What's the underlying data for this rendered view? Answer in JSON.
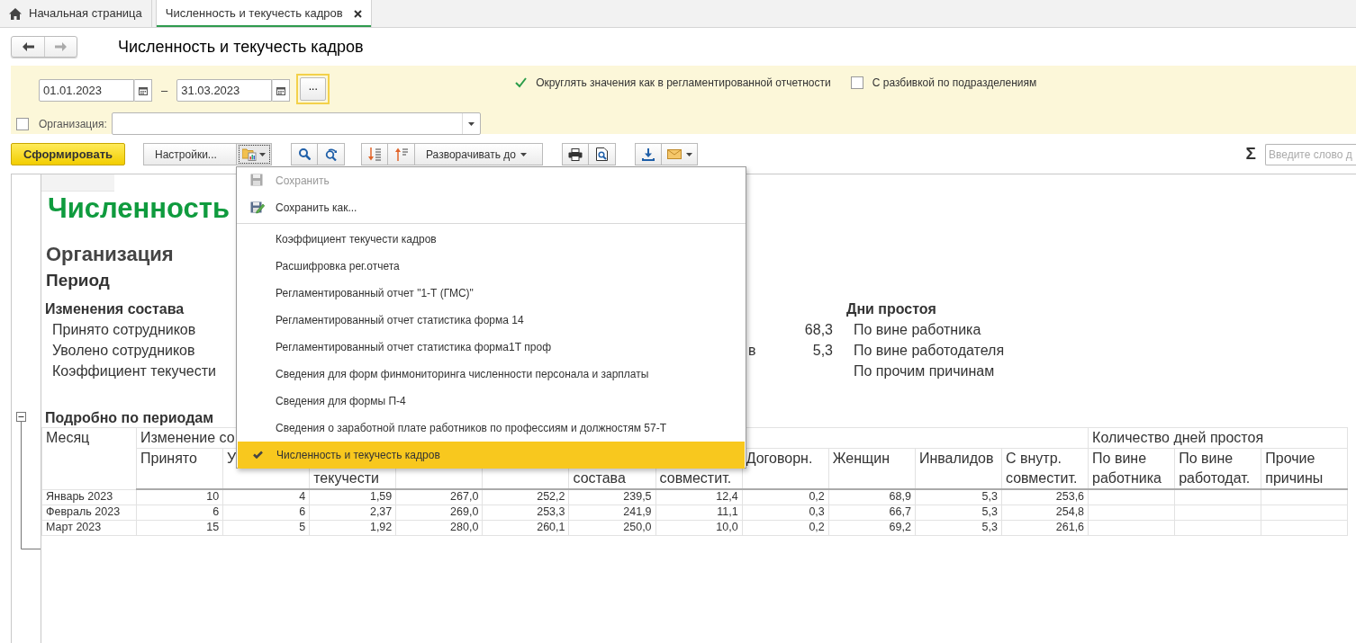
{
  "tabs": [
    {
      "label": "Начальная страница",
      "kind": "home",
      "selected": false,
      "closable": false
    },
    {
      "label": "Численность и текучесть кадров",
      "kind": "document",
      "selected": true,
      "closable": true
    }
  ],
  "title": "Численность и текучесть кадров",
  "filters": {
    "date_from": "01.01.2023",
    "dash": "–",
    "date_to": "31.03.2023",
    "more": "...",
    "options": [
      {
        "label": "Округлять значения как в регламентированной отчетности",
        "checked": true
      },
      {
        "label": "С разбивкой по подразделениям",
        "checked": false
      }
    ],
    "organization": {
      "label": "Организация:",
      "checked": false
    }
  },
  "toolbar": {
    "generate": "Сформировать",
    "settings": "Настройки...",
    "expand": "Разворачивать до",
    "sum": "Σ",
    "search_placeholder": "Введите слово д"
  },
  "menu": {
    "commands": [
      {
        "label": "Сохранить",
        "kind": "save",
        "disabled": true
      },
      {
        "label": "Сохранить как...",
        "kind": "save_as",
        "disabled": false
      }
    ],
    "variants": [
      {
        "label": "Коэффициент текучести кадров",
        "selected": false
      },
      {
        "label": "Расшифровка рег.отчета",
        "selected": false
      },
      {
        "label": "Регламентированный отчет \"1-Т (ГМС)\"",
        "selected": false
      },
      {
        "label": "Регламентированный отчет статистика форма 14",
        "selected": false
      },
      {
        "label": "Регламентированный отчет статистика форма1Т проф",
        "selected": false
      },
      {
        "label": "Сведения для форм финмониторинга численности персонала и зарплаты",
        "selected": false
      },
      {
        "label": "Сведения для формы П-4",
        "selected": false
      },
      {
        "label": "Сведения о заработной плате работников по профессиям и должностям 57-Т",
        "selected": false
      },
      {
        "label": "Численность и текучесть кадров",
        "selected": true
      }
    ]
  },
  "report": {
    "title": "Численность",
    "organization": "Организация",
    "period": "Период",
    "summary": {
      "left_heading": "Изменения состава",
      "left_items": [
        "Принято сотрудников",
        "Уволено сотрудников",
        "Коэффициент текучести"
      ],
      "middle": [
        {
          "value": "68,3"
        },
        {
          "label": "в",
          "value": "5,3"
        }
      ],
      "right_heading": "Дни простоя",
      "right_items": [
        "По вине работника",
        "По вине работодателя",
        "По прочим причинам"
      ]
    },
    "details": {
      "title": "Подробно по периодам",
      "expanded": true,
      "month": "Месяц",
      "group": "Изменение со",
      "downtime": "Количество дней простоя",
      "columns": [
        {
          "label": "Принято"
        },
        {
          "label": "У"
        },
        {
          "label": "текучести",
          "cut_top": true
        },
        null,
        null,
        {
          "label": "состава",
          "cut_top": true
        },
        {
          "label": "совместит.",
          "cut_top": true
        },
        {
          "label": "Договорн."
        },
        {
          "label": "Женщин"
        },
        {
          "label": "Инвалидов"
        },
        {
          "label": "С внутр. совместит."
        },
        {
          "label": "По вине работника"
        },
        {
          "label": "По вине работодат."
        },
        {
          "label": "Прочие причины"
        }
      ],
      "rows": [
        {
          "month": "Январь 2023",
          "values": [
            "10",
            "4",
            "1,59",
            "267,0",
            "252,2",
            "239,5",
            "12,4",
            "0,2",
            "68,9",
            "5,3",
            "253,6"
          ]
        },
        {
          "month": "Февраль 2023",
          "values": [
            "6",
            "6",
            "2,37",
            "269,0",
            "253,3",
            "241,9",
            "11,1",
            "0,3",
            "66,7",
            "5,3",
            "254,8"
          ]
        },
        {
          "month": "Март 2023",
          "values": [
            "15",
            "5",
            "1,92",
            "280,0",
            "260,1",
            "250,0",
            "10,0",
            "0,2",
            "69,2",
            "5,3",
            "261,6"
          ]
        }
      ]
    }
  }
}
